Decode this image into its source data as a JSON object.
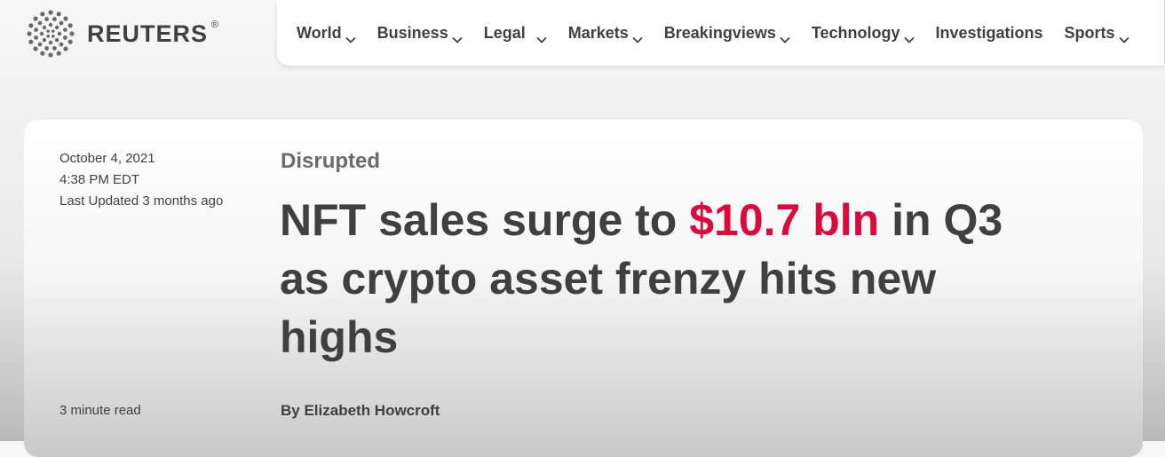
{
  "brand": {
    "name": "REUTERS",
    "registered_mark": "®",
    "logo_icon": "reuters-dots-icon"
  },
  "nav": {
    "items": [
      {
        "label": "World",
        "has_dropdown": true
      },
      {
        "label": "Business",
        "has_dropdown": true
      },
      {
        "label": "Legal",
        "has_dropdown": true
      },
      {
        "label": "Markets",
        "has_dropdown": true
      },
      {
        "label": "Breakingviews",
        "has_dropdown": true
      },
      {
        "label": "Technology",
        "has_dropdown": true
      },
      {
        "label": "Investigations",
        "has_dropdown": false
      },
      {
        "label": "Sports",
        "has_dropdown": true
      }
    ],
    "dropdown_icon": "chevron-down-icon"
  },
  "article": {
    "date": "October 4, 2021",
    "time": "4:38 PM EDT",
    "last_updated": "Last Updated 3 months ago",
    "read_time": "3 minute read",
    "kicker": "Disrupted",
    "headline": {
      "before": "NFT sales surge to ",
      "highlight": "$10.7 bln",
      "after": " in Q3 as crypto asset frenzy hits new highs"
    },
    "byline": "By Elizabeth Howcroft"
  },
  "colors": {
    "text": "#404040",
    "kicker": "#6b6b6b",
    "highlight": "#dc0a3c",
    "nav_background": "#ffffff"
  }
}
